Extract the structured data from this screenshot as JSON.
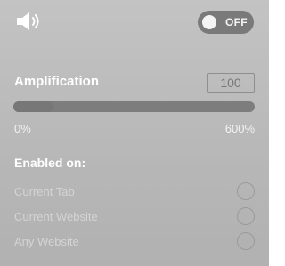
{
  "toggle": {
    "label": "OFF",
    "state": "off"
  },
  "speaker": {
    "icon": "speaker-volume-icon"
  },
  "amplification": {
    "label": "Amplification",
    "value": "100",
    "slider_fraction": 0.1667,
    "min_label": "0%",
    "max_label": "600%"
  },
  "enabled_on": {
    "heading": "Enabled on:",
    "options": [
      {
        "label": "Current Tab"
      },
      {
        "label": "Current Website"
      },
      {
        "label": "Any Website"
      }
    ]
  },
  "colors": {
    "background": "#bdbdbd",
    "track": "#7d7d7d",
    "toggle_bg": "#7a7a7a"
  }
}
